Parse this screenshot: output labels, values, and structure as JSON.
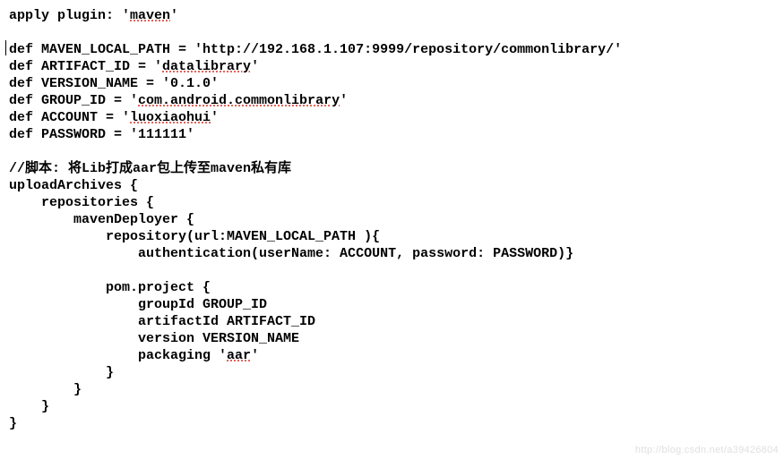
{
  "code": {
    "line01a": "apply plugin: '",
    "line01b": "maven",
    "line01c": "'",
    "blank1": "",
    "line02": "def MAVEN_LOCAL_PATH = 'http://192.168.1.107:9999/repository/commonlibrary/'",
    "line03a": "def ARTIFACT_ID = '",
    "line03b": "datalibrary",
    "line03c": "'",
    "line04": "def VERSION_NAME = '0.1.0'",
    "line05a": "def GROUP_ID = '",
    "line05b": "com.android.commonlibrary",
    "line05c": "'",
    "line06a": "def ACCOUNT = '",
    "line06b": "luoxiaohui",
    "line06c": "'",
    "line07": "def PASSWORD = '111111'",
    "blank2": "",
    "line08": "//脚本: 将Lib打成aar包上传至maven私有库",
    "line09": "uploadArchives {",
    "line10": "    repositories {",
    "line11": "        mavenDeployer {",
    "line12": "            repository(url:MAVEN_LOCAL_PATH ){",
    "line13": "                authentication(userName: ACCOUNT, password: PASSWORD)}",
    "blank3": "",
    "line14": "            pom.project {",
    "line15": "                groupId GROUP_ID",
    "line16": "                artifactId ARTIFACT_ID",
    "line17": "                version VERSION_NAME",
    "line18a": "                packaging '",
    "line18b": "aar",
    "line18c": "'",
    "line19": "            }",
    "line20": "        }",
    "line21": "    }",
    "line22": "}"
  },
  "watermark": "http://blog.csdn.net/a39426804"
}
